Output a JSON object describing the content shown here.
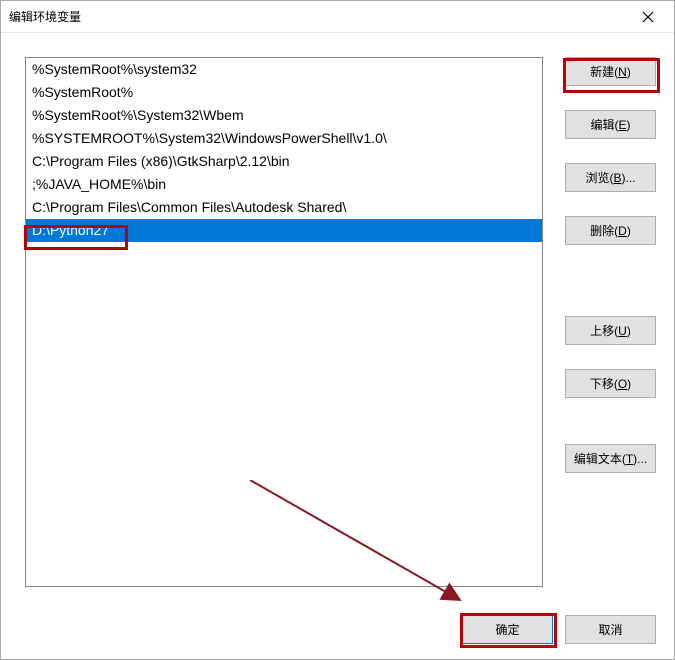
{
  "dialog": {
    "title": "编辑环境变量"
  },
  "list": {
    "items": [
      "%SystemRoot%\\system32",
      "%SystemRoot%",
      "%SystemRoot%\\System32\\Wbem",
      "%SYSTEMROOT%\\System32\\WindowsPowerShell\\v1.0\\",
      "C:\\Program Files (x86)\\GtkSharp\\2.12\\bin",
      ";%JAVA_HOME%\\bin",
      "C:\\Program Files\\Common Files\\Autodesk Shared\\",
      "D:\\Python27"
    ],
    "selected_index": 7
  },
  "buttons": {
    "new": {
      "label": "新建(",
      "accel": "N",
      "suffix": ")"
    },
    "edit": {
      "label": "编辑(",
      "accel": "E",
      "suffix": ")"
    },
    "browse": {
      "label": "浏览(",
      "accel": "B",
      "suffix": ")..."
    },
    "delete": {
      "label": "删除(",
      "accel": "D",
      "suffix": ")"
    },
    "moveup": {
      "label": "上移(",
      "accel": "U",
      "suffix": ")"
    },
    "movedown": {
      "label": "下移(",
      "accel": "O",
      "suffix": ")"
    },
    "edittext": {
      "label": "编辑文本(",
      "accel": "T",
      "suffix": ")..."
    },
    "ok": "确定",
    "cancel": "取消"
  }
}
